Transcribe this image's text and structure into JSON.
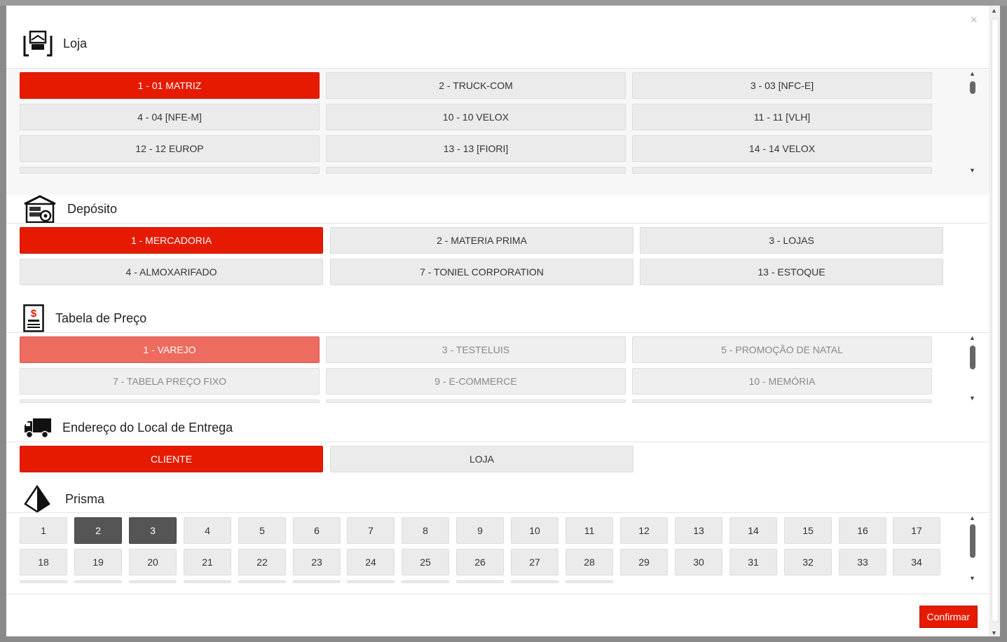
{
  "loja": {
    "title": "Loja",
    "items": [
      "1 - 01 MATRIZ",
      "2 - TRUCK-COM",
      "3 - 03 [NFC-E]",
      "4 - 04 [NFE-M]",
      "10 - 10 VELOX",
      "11 - 11 [VLH]",
      "12 - 12 EUROP",
      "13 - 13 [FIORI]",
      "14 - 14 VELOX"
    ],
    "selected": "1 - 01 MATRIZ"
  },
  "deposito": {
    "title": "Depósito",
    "items": [
      "1 - MERCADORIA",
      "2 - MATERIA PRIMA",
      "3 - LOJAS",
      "4 - ALMOXARIFADO",
      "7 - TONIEL CORPORATION",
      "13 - ESTOQUE"
    ],
    "selected": "1 - MERCADORIA"
  },
  "tabela": {
    "title": "Tabela de Preço",
    "items": [
      "1 - VAREJO",
      "3 - TESTELUIS",
      "5 - PROMOÇÃO DE NATAL",
      "7 - TABELA PREÇO FIXO",
      "9 - E-COMMERCE",
      "10 - MEMÓRIA"
    ],
    "selected": "1 - VAREJO"
  },
  "endereco": {
    "title": "Endereço do Local de Entrega",
    "items": [
      "CLIENTE",
      "LOJA"
    ],
    "selected": "CLIENTE"
  },
  "prisma": {
    "title": "Prisma",
    "row1": [
      "1",
      "2",
      "3",
      "4",
      "5",
      "6",
      "7",
      "8",
      "9",
      "10",
      "11",
      "12",
      "13",
      "14",
      "15",
      "16",
      "17"
    ],
    "row2": [
      "18",
      "19",
      "20",
      "21",
      "22",
      "23",
      "24",
      "25",
      "26",
      "27",
      "28",
      "29",
      "30",
      "31",
      "32",
      "33",
      "34"
    ],
    "selected": [
      "2",
      "3"
    ]
  },
  "close_label": "×",
  "confirm_label": "Confirmar",
  "colors": {
    "accent": "#e51a00",
    "accent_light": "#ee6b5f",
    "prisma_selected": "#555555"
  },
  "icons": [
    "loja-icon",
    "deposito-icon",
    "tabela-preco-icon",
    "truck-icon",
    "prisma-icon",
    "close-icon"
  ]
}
